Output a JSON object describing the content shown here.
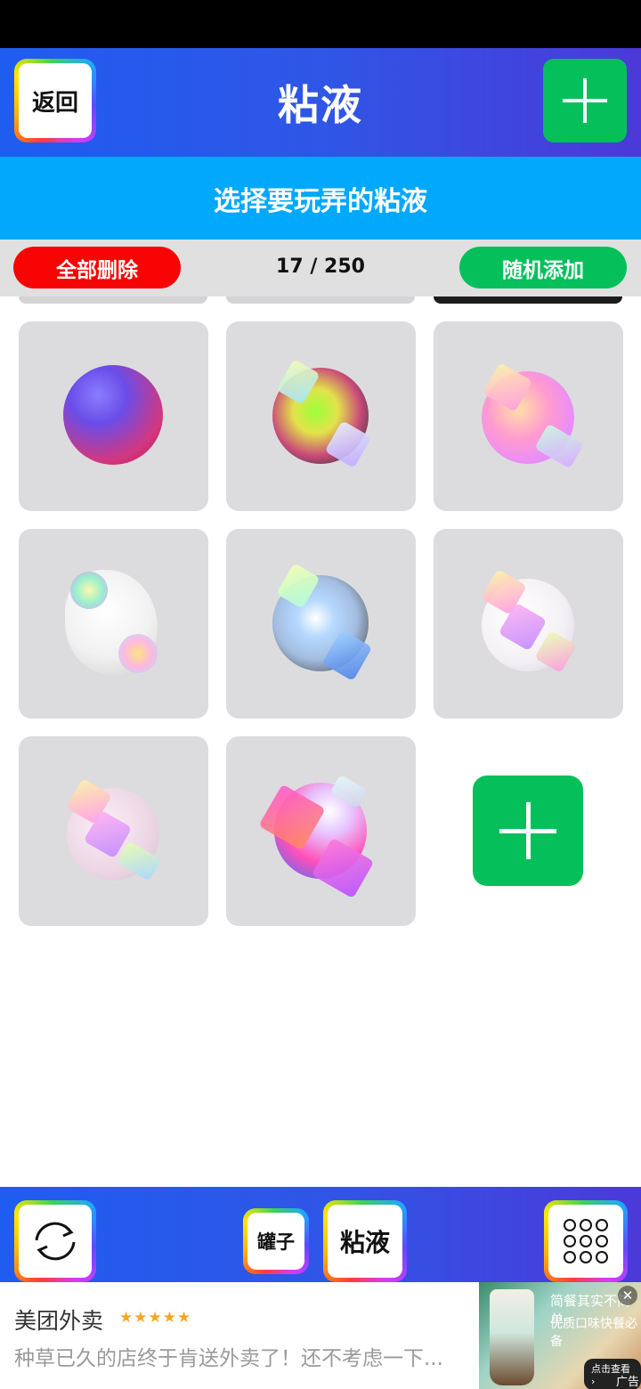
{
  "header": {
    "back_label": "返回",
    "title": "粘液"
  },
  "subheader": "选择要玩弄的粘液",
  "actions": {
    "delete_all_label": "全部删除",
    "counter": "17 / 250",
    "random_add_label": "随机添加"
  },
  "slimes": [
    {
      "name": "slime-1"
    },
    {
      "name": "slime-2"
    },
    {
      "name": "slime-3"
    },
    {
      "name": "slime-4"
    },
    {
      "name": "slime-5"
    },
    {
      "name": "slime-6"
    },
    {
      "name": "slime-7"
    },
    {
      "name": "slime-8"
    }
  ],
  "footer": {
    "jar_label": "罐子",
    "slime_label": "粘液"
  },
  "ad": {
    "brand": "美团外卖",
    "stars": "★★★★★",
    "text": "种草已久的店终于肯送外卖了！还不考虑一下...",
    "image_line1": "简餐其实不简单",
    "image_line2": "优质口味快餐必备",
    "image_cta": "点击查看 ›",
    "close_glyph": "✕",
    "tag": "广告"
  },
  "colors": {
    "header": "#1f5cf0",
    "subbar": "#02a8fb",
    "green": "#05c05a",
    "red": "#f90404",
    "tile": "#dcdcdf"
  }
}
